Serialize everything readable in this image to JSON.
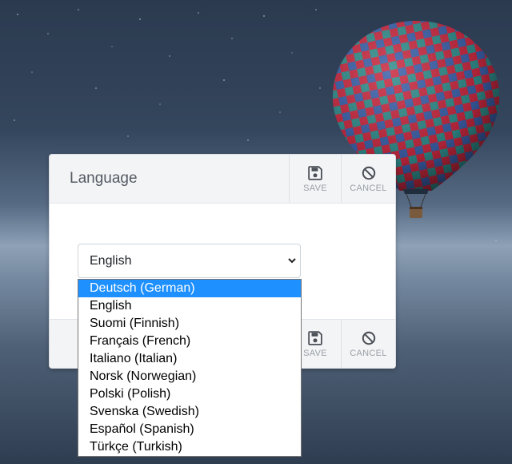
{
  "dialog": {
    "title": "Language",
    "header_buttons": {
      "save_label": "SAVE",
      "cancel_label": "CANCEL"
    },
    "footer_buttons": {
      "save_label": "SAVE",
      "cancel_label": "CANCEL"
    }
  },
  "language_select": {
    "selected": "English",
    "highlighted": "Deutsch (German)",
    "options": [
      "Deutsch (German)",
      "English",
      "Suomi (Finnish)",
      "Français (French)",
      "Italiano (Italian)",
      "Norsk (Norwegian)",
      "Polski (Polish)",
      "Svenska (Swedish)",
      "Español (Spanish)",
      "Türkçe (Turkish)"
    ]
  },
  "icons": {
    "save": "floppy-disk-icon",
    "cancel": "ban-icon",
    "dropdown": "chevron-down-icon"
  },
  "colors": {
    "highlight": "#1e90ff",
    "panel_header": "#f3f4f6"
  }
}
